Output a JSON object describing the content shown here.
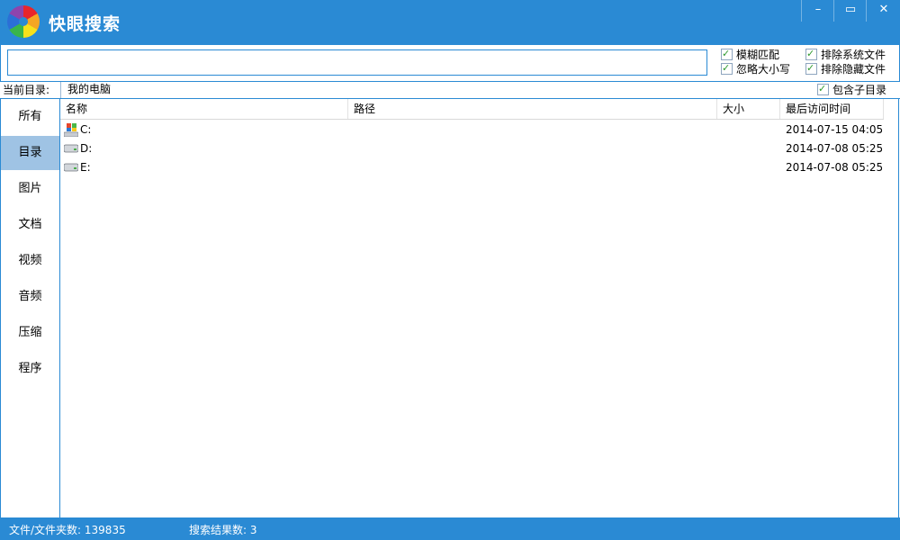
{
  "app": {
    "title": "快眼搜索"
  },
  "window_controls": {
    "minimize": "–",
    "maximize": "▭",
    "close": "✕"
  },
  "search": {
    "value": "",
    "placeholder": ""
  },
  "options": {
    "fuzzy_match": "模糊匹配",
    "ignore_case": "忽略大小写",
    "exclude_system": "排除系统文件",
    "exclude_hidden": "排除隐藏文件",
    "include_subdirs": "包含子目录"
  },
  "pathbar": {
    "label": "当前目录:",
    "value": "我的电脑"
  },
  "sidebar": {
    "active": "目录",
    "items": [
      "所有",
      "目录",
      "图片",
      "文档",
      "视频",
      "音频",
      "压缩",
      "程序"
    ]
  },
  "columns": {
    "name": "名称",
    "path": "路径",
    "size": "大小",
    "last_access": "最后访问时间"
  },
  "rows": [
    {
      "name": "C:",
      "path": "",
      "size": "",
      "time": "2014-07-15 04:05",
      "icon": "windows-drive-icon"
    },
    {
      "name": "D:",
      "path": "",
      "size": "",
      "time": "2014-07-08 05:25",
      "icon": "hard-drive-icon"
    },
    {
      "name": "E:",
      "path": "",
      "size": "",
      "time": "2014-07-08 05:25",
      "icon": "hard-drive-icon"
    }
  ],
  "status": {
    "files_count": "文件/文件夹数: 139835",
    "results_count": "搜索结果数: 3"
  },
  "colors": {
    "accent": "#2a8ad4",
    "selected": "#9fc3e4",
    "check": "#2e9a2e"
  }
}
